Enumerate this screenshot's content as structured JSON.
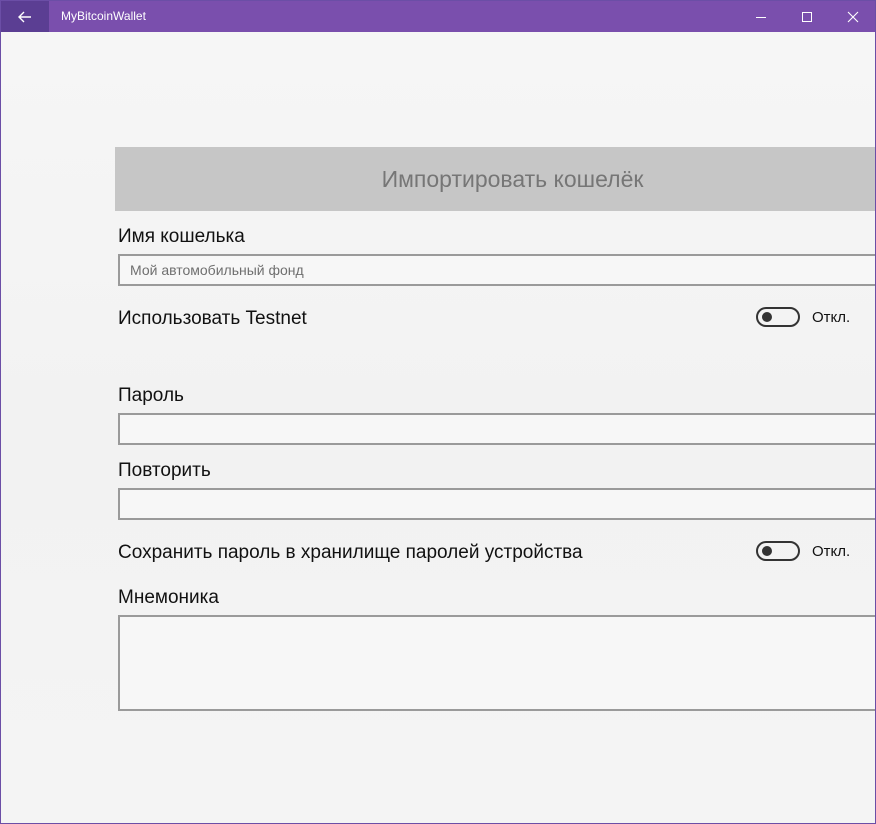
{
  "window": {
    "title": "MyBitcoinWallet",
    "accent_color": "#7a4fad",
    "back_button_color": "#5b3e93",
    "controls": [
      "minimize-icon",
      "maximize-icon",
      "close-icon"
    ]
  },
  "form": {
    "header": "Импортировать кошелёк",
    "wallet_name": {
      "label": "Имя кошелька",
      "placeholder": "Мой автомобильный фонд",
      "value": ""
    },
    "testnet": {
      "label": "Использовать Testnet",
      "state": "Откл."
    },
    "password": {
      "label": "Пароль",
      "value": ""
    },
    "repeat": {
      "label": "Повторить",
      "value": ""
    },
    "save_password": {
      "label": "Сохранить пароль в хранилище паролей устройства",
      "state": "Откл."
    },
    "mnemonic": {
      "label": "Мнемоника",
      "value": ""
    }
  }
}
